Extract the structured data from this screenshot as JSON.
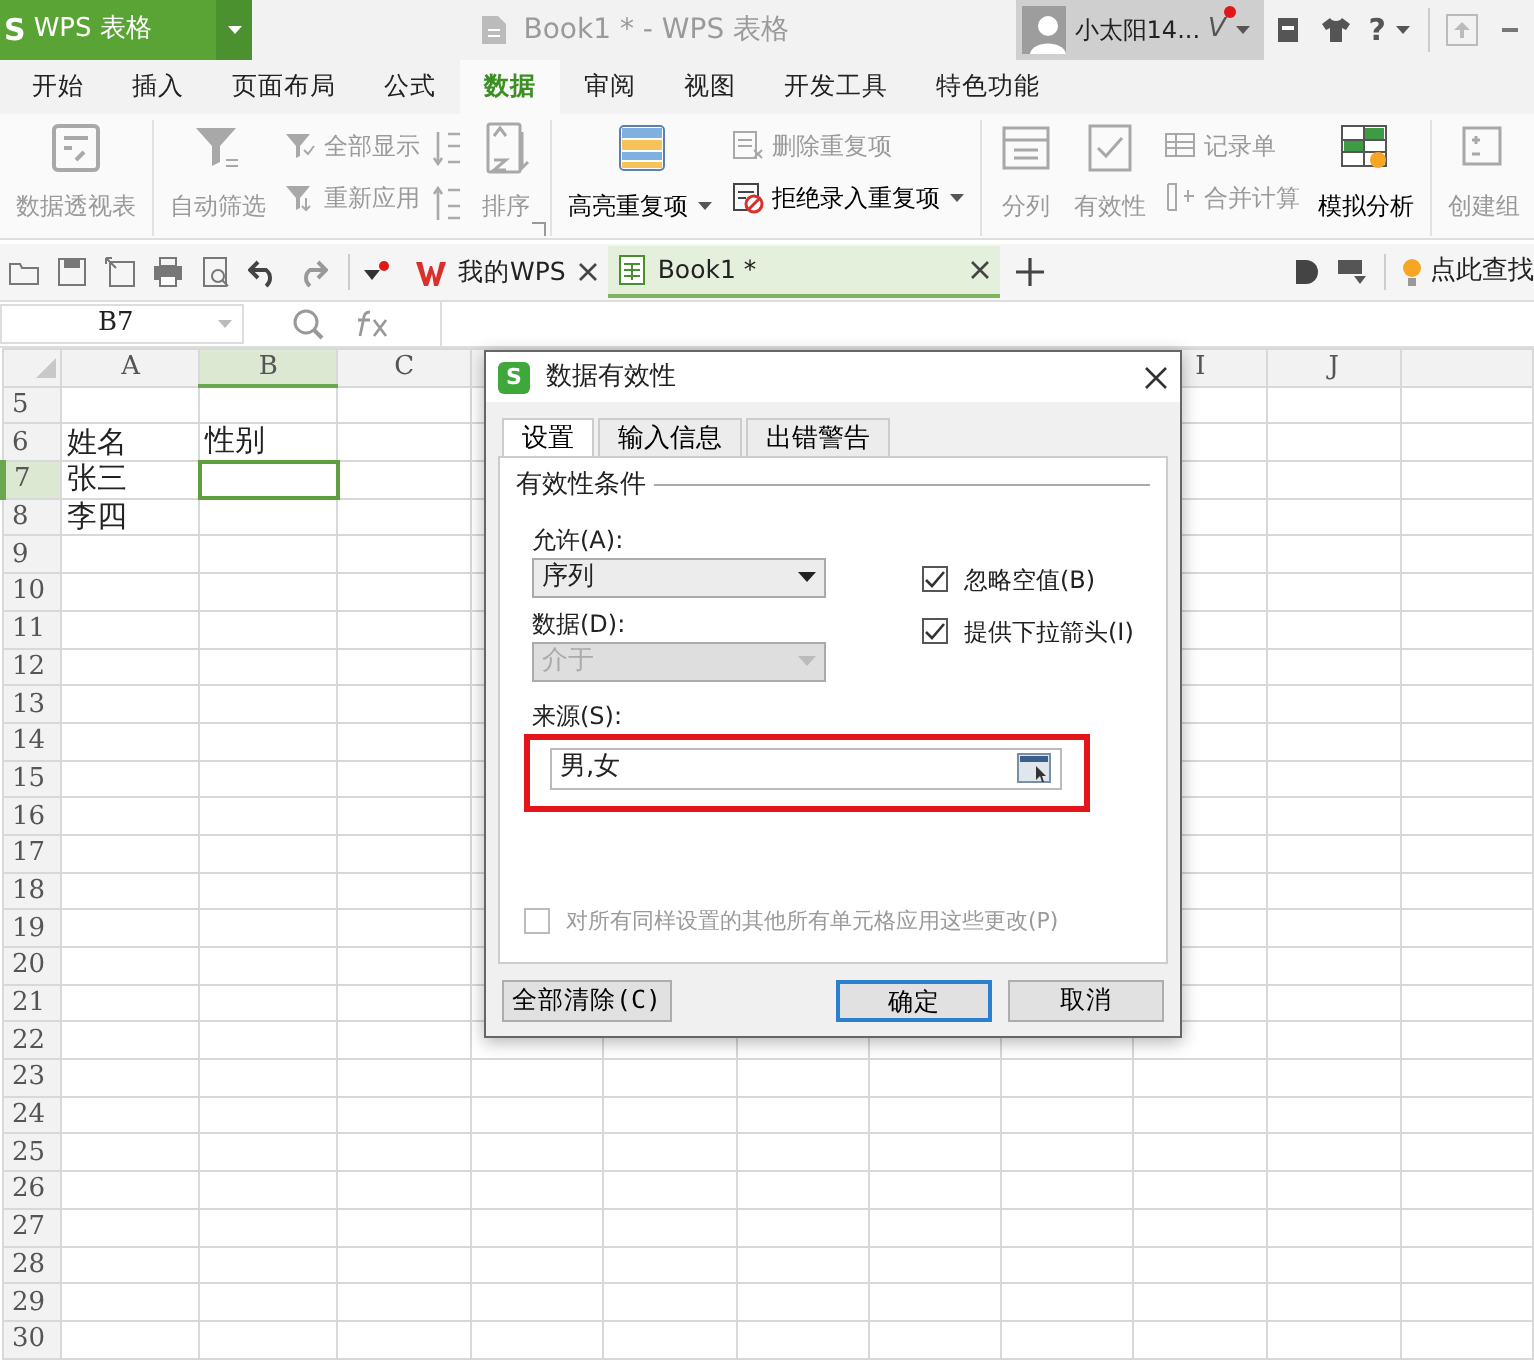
{
  "title_bar": {
    "logo": "S",
    "app_menu": "WPS 表格",
    "title": "Book1 * - WPS 表格",
    "user": "小太阳14...",
    "vip": "V",
    "help": "?"
  },
  "menu_tabs": [
    {
      "label": "开始",
      "selected": false
    },
    {
      "label": "插入",
      "selected": false
    },
    {
      "label": "页面布局",
      "selected": false
    },
    {
      "label": "公式",
      "selected": false
    },
    {
      "label": "数据",
      "selected": true
    },
    {
      "label": "审阅",
      "selected": false
    },
    {
      "label": "视图",
      "selected": false
    },
    {
      "label": "开发工具",
      "selected": false
    },
    {
      "label": "特色功能",
      "selected": false
    }
  ],
  "ribbon": [
    {
      "items": [
        {
          "kind": "large",
          "label": "数据透视表",
          "disabled": true,
          "dropdown": false
        }
      ]
    },
    {
      "launcher": true,
      "items": [
        {
          "kind": "large",
          "label": "自动筛选",
          "disabled": true,
          "dropdown": false
        },
        {
          "kind": "stack",
          "items": [
            {
              "label": "全部显示",
              "disabled": true,
              "dropdown": false
            },
            {
              "label": "重新应用",
              "disabled": true,
              "dropdown": false
            }
          ]
        },
        {
          "kind": "sort_icons"
        },
        {
          "kind": "large",
          "label": "排序",
          "disabled": true,
          "dropdown": false
        }
      ]
    },
    {
      "items": [
        {
          "kind": "large",
          "label": "高亮重复项",
          "disabled": false,
          "dropdown": true
        },
        {
          "kind": "stack",
          "items": [
            {
              "label": "删除重复项",
              "disabled": true,
              "dropdown": false
            },
            {
              "label": "拒绝录入重复项",
              "disabled": false,
              "dropdown": true
            }
          ]
        }
      ]
    },
    {
      "items": [
        {
          "kind": "large",
          "label": "分列",
          "disabled": true,
          "dropdown": false
        },
        {
          "kind": "large",
          "label": "有效性",
          "disabled": true,
          "dropdown": false
        },
        {
          "kind": "stack",
          "items": [
            {
              "label": "记录单",
              "disabled": true,
              "dropdown": false
            },
            {
              "label": "合并计算",
              "disabled": true,
              "dropdown": false
            }
          ]
        },
        {
          "kind": "large",
          "label": "模拟分析",
          "disabled": false,
          "dropdown": false
        }
      ]
    },
    {
      "items": [
        {
          "kind": "large",
          "label": "创建组",
          "disabled": true,
          "dropdown": false
        }
      ]
    }
  ],
  "doc_tabs": [
    {
      "label": "我的WPS",
      "selected": false
    },
    {
      "label": "Book1 *",
      "selected": true
    }
  ],
  "find_hint": "点此查找",
  "formula_bar": {
    "name_box": "B7"
  },
  "grid": {
    "columns_left": [
      {
        "label": "A",
        "selected": false
      },
      {
        "label": "B",
        "selected": true
      },
      {
        "label": "C",
        "selected": false
      }
    ],
    "columns_right": [
      {
        "label": "I",
        "selected": false
      },
      {
        "label": "J",
        "selected": false
      }
    ],
    "rows": [
      {
        "number": "5",
        "selected": false,
        "cells": []
      },
      {
        "number": "6",
        "selected": false,
        "cells": [
          "姓名",
          "性别"
        ]
      },
      {
        "number": "7",
        "selected": true,
        "cells": [
          "张三"
        ]
      },
      {
        "number": "8",
        "selected": false,
        "cells": [
          "李四"
        ]
      },
      {
        "number": "9",
        "selected": false,
        "cells": []
      },
      {
        "number": "10",
        "selected": false,
        "cells": []
      },
      {
        "number": "11",
        "selected": false,
        "cells": []
      },
      {
        "number": "12",
        "selected": false,
        "cells": []
      },
      {
        "number": "13",
        "selected": false,
        "cells": []
      },
      {
        "number": "14",
        "selected": false,
        "cells": []
      },
      {
        "number": "15",
        "selected": false,
        "cells": []
      },
      {
        "number": "16",
        "selected": false,
        "cells": []
      },
      {
        "number": "17",
        "selected": false,
        "cells": []
      },
      {
        "number": "18",
        "selected": false,
        "cells": []
      },
      {
        "number": "19",
        "selected": false,
        "cells": []
      },
      {
        "number": "20",
        "selected": false,
        "cells": []
      },
      {
        "number": "21",
        "selected": false,
        "cells": []
      },
      {
        "number": "22",
        "selected": false,
        "cells": []
      },
      {
        "number": "23",
        "selected": false,
        "cells": []
      },
      {
        "number": "24",
        "selected": false,
        "cells": []
      },
      {
        "number": "25",
        "selected": false,
        "cells": []
      },
      {
        "number": "26",
        "selected": false,
        "cells": []
      },
      {
        "number": "27",
        "selected": false,
        "cells": []
      },
      {
        "number": "28",
        "selected": false,
        "cells": []
      },
      {
        "number": "29",
        "selected": false,
        "cells": []
      },
      {
        "number": "30",
        "selected": false,
        "cells": []
      }
    ]
  },
  "dialog": {
    "logo": "S",
    "title": "数据有效性",
    "tabs": [
      {
        "label": "设置",
        "selected": true
      },
      {
        "label": "输入信息",
        "selected": false
      },
      {
        "label": "出错警告",
        "selected": false
      }
    ],
    "section": "有效性条件",
    "allow": {
      "label": "允许(A):",
      "value": "序列",
      "disabled": false
    },
    "data": {
      "label": "数据(D):",
      "value": "介于",
      "disabled": true
    },
    "options": [
      {
        "label": "忽略空值(B)",
        "checked": true,
        "disabled": false
      },
      {
        "label": "提供下拉箭头(I)",
        "checked": true,
        "disabled": false
      }
    ],
    "source": {
      "label": "来源(S):",
      "value": "男,女",
      "highlighted": true
    },
    "apply_all": {
      "label": "对所有同样设置的其他所有单元格应用这些更改(P)",
      "checked": false,
      "disabled": true
    },
    "buttons": [
      {
        "label": "全部清除(C)",
        "kind": "left",
        "default": false
      },
      {
        "label": "确定",
        "kind": "right",
        "default": true
      },
      {
        "label": "取消",
        "kind": "right",
        "default": false
      }
    ]
  }
}
